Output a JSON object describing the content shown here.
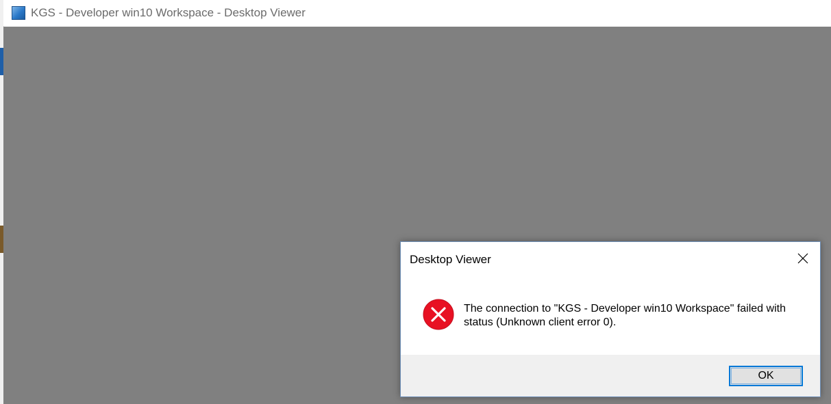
{
  "window": {
    "title": "KGS - Developer win10 Workspace - Desktop Viewer",
    "icon": "app-window-icon",
    "viewer_background": "#808080"
  },
  "dialog": {
    "title": "Desktop Viewer",
    "close_icon": "close-icon",
    "error_icon": "error-icon",
    "error_color": "#e81123",
    "message": "The connection to \"KGS - Developer win10 Workspace\" failed with status (Unknown client error 0).",
    "ok_label": "OK",
    "focus_color": "#0078d7"
  }
}
